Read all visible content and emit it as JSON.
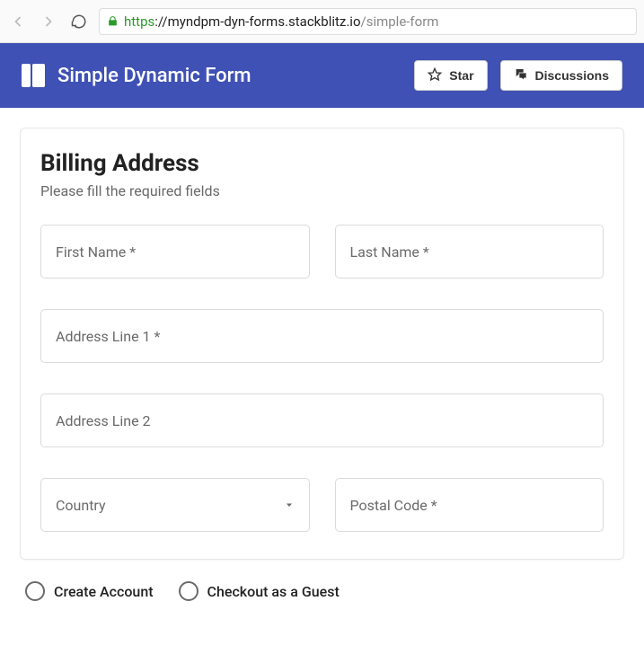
{
  "browser": {
    "url_scheme": "https",
    "url_host": "://myndpm-dyn-forms.stackblitz.io",
    "url_path": "/simple-form"
  },
  "header": {
    "title": "Simple Dynamic Form",
    "star_label": "Star",
    "discussions_label": "Discussions"
  },
  "card": {
    "title": "Billing Address",
    "subtitle": "Please fill the required fields"
  },
  "form": {
    "first_name_label": "First Name *",
    "last_name_label": "Last Name *",
    "address1_label": "Address Line 1 *",
    "address2_label": "Address Line 2",
    "country_label": "Country",
    "postal_label": "Postal Code *"
  },
  "radios": {
    "create_account": "Create Account",
    "guest_checkout": "Checkout as a Guest"
  }
}
